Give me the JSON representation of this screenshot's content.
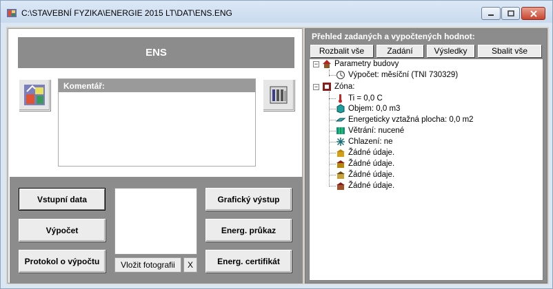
{
  "window": {
    "title": "C:\\STAVEBNÍ FYZIKA\\ENERGIE 2015 LT\\DAT\\ENS.ENG"
  },
  "left": {
    "header": "ENS",
    "comment_label": "Komentář:",
    "buttons": {
      "input_data": "Vstupní data",
      "calculation": "Výpočet",
      "protocol": "Protokol o výpočtu",
      "graphic_output": "Grafický výstup",
      "energy_label": "Energ. průkaz",
      "energy_certificate": "Energ. certifikát",
      "insert_photo": "Vložit fotografii",
      "remove_photo": "X"
    }
  },
  "right": {
    "title": "Přehled zadaných a vypočtených hodnot:",
    "tabs": {
      "expand": "Rozbalit vše",
      "input": "Zadání",
      "results": "Výsledky",
      "collapse": "Sbalit vše"
    },
    "tree": {
      "building": "Parametry budovy",
      "calc": "Výpočet: měsíční (TNI 730329)",
      "zone": "Zóna:",
      "ti": "Ti = 0,0 C",
      "volume": "Objem: 0,0 m3",
      "area": "Energeticky vztažná plocha: 0,0 m2",
      "ventilation": "Větrání: nucené",
      "cooling": "Chlazení: ne",
      "none1": "Žádné údaje.",
      "none2": "Žádné údaje.",
      "none3": "Žádné údaje.",
      "none4": "Žádné údaje."
    }
  },
  "colors": {
    "panel_gray": "#8c8c8c",
    "client": "#d4d0c8",
    "close_red": "#c9452f"
  }
}
